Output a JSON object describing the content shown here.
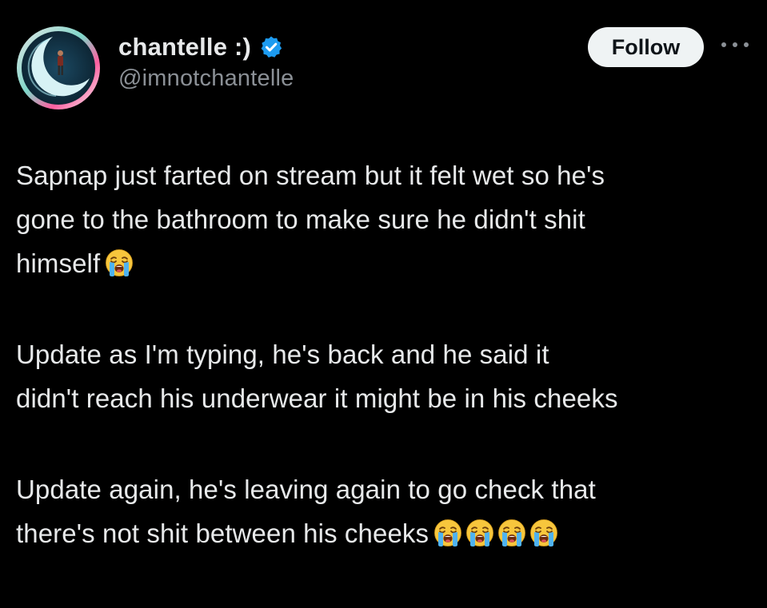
{
  "author": {
    "display_name": "chantelle :)",
    "handle": "@imnotchantelle",
    "verified": true,
    "avatar_icon": "crescent-moon-avatar"
  },
  "actions": {
    "follow_label": "Follow",
    "more_icon": "more-options-icon"
  },
  "post": {
    "paragraphs": [
      {
        "lines": [
          "Sapnap just farted on stream but it felt wet so he's",
          "gone to the bathroom to make sure he didn't shit",
          "himself"
        ],
        "trailing_emoji_count": 1
      },
      {
        "lines": [
          "Update as I'm typing, he's back and he said it",
          "didn't reach his underwear it might be in his cheeks"
        ],
        "trailing_emoji_count": 0
      },
      {
        "lines": [
          "Update again, he's leaving again to go check that",
          "there's not shit between his cheeks"
        ],
        "trailing_emoji_count": 4
      }
    ],
    "emoji_name": "loudly-crying-face"
  },
  "colors": {
    "background": "#000000",
    "text": "#e7e9ea",
    "secondary_text": "#8b9096",
    "verified_badge": "#1d9bf0",
    "follow_button_bg": "#eff3f4"
  }
}
